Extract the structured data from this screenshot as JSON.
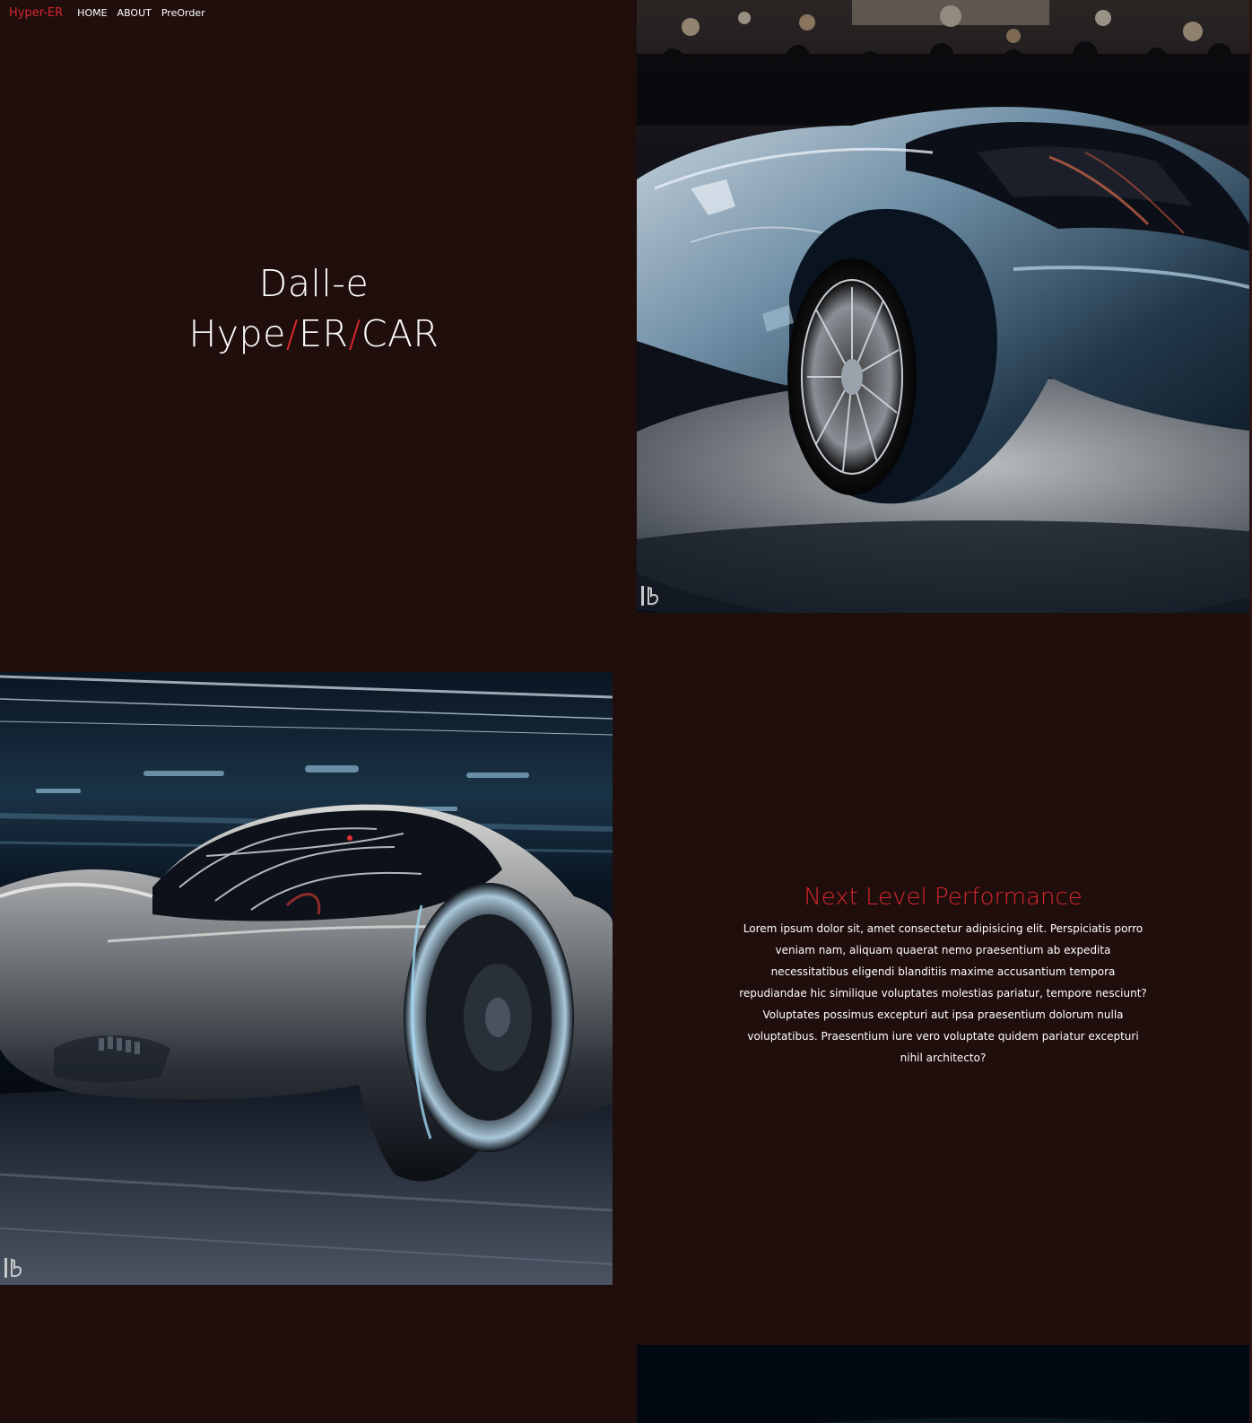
{
  "nav": {
    "brand": "Hyper-ER",
    "links": [
      "HOME",
      "ABOUT",
      "PreOrder"
    ]
  },
  "hero": {
    "line1": "Dall-e",
    "line2_parts": [
      "Hype",
      "/",
      "ER",
      "/",
      "CAR"
    ]
  },
  "feature": {
    "title": "Next Level Performance",
    "body": "Lorem ipsum dolor sit, amet consectetur adipisicing elit. Perspiciatis porro veniam nam, aliquam quaerat nemo praesentium ab expedita necessitatibus eligendi blanditiis maxime accusantium tempora repudiandae hic similique voluptates molestias pariatur, tempore nesciunt? Voluptates possimus excepturi aut ipsa praesentium dolorum nulla voluptatibus. Praesentium iure vero voluptate quidem pariatur excepturi nihil architecto?"
  },
  "images": [
    {
      "subject": "silver futuristic hypercar at auto show"
    },
    {
      "subject": "dark futuristic hypercar in motion"
    },
    {
      "subject": "dark car image (partially visible)"
    }
  ],
  "colors": {
    "background": "#1f0e0c",
    "accent": "#d5262e",
    "text": "#ffffff"
  }
}
